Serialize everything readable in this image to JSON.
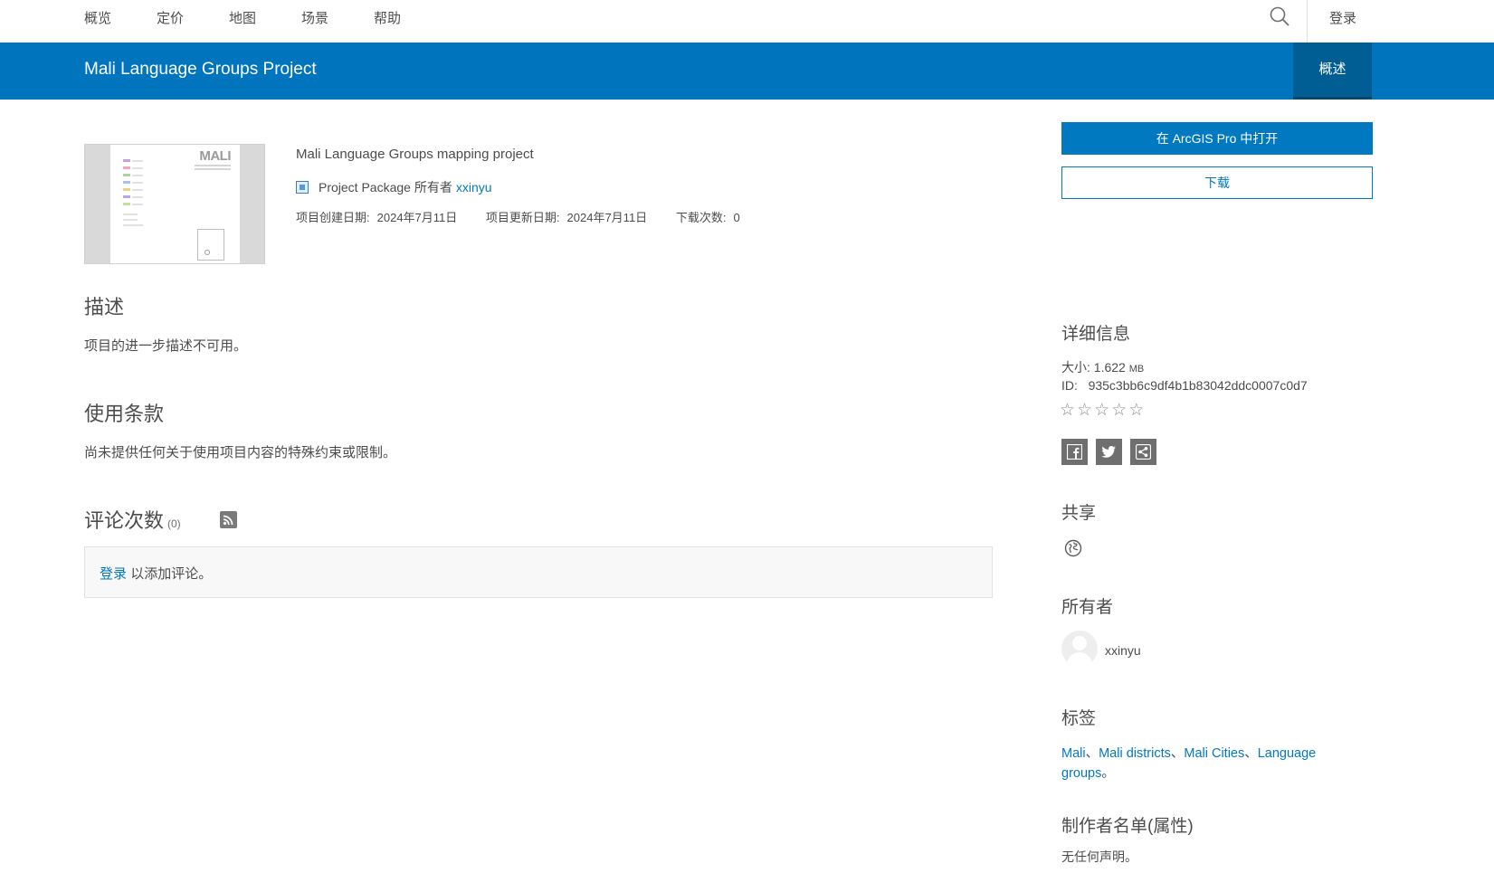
{
  "nav": {
    "items": [
      "概览",
      "定价",
      "地图",
      "场景",
      "帮助"
    ],
    "login": "登录"
  },
  "titlebar": {
    "title": "Mali Language Groups Project",
    "tab": "概述"
  },
  "thumbnail": {
    "map_title": "MALI"
  },
  "item": {
    "snippet": "Mali Language Groups mapping project",
    "type": "Project Package",
    "owner_prefix": "所有者",
    "owner": "xxinyu",
    "created_label": "项目创建日期:",
    "created_value": "2024年7月11日",
    "updated_label": "项目更新日期:",
    "updated_value": "2024年7月11日",
    "downloads_label": "下载次数:",
    "downloads_value": "0"
  },
  "description": {
    "heading": "描述",
    "text": "项目的进一步描述不可用。"
  },
  "terms": {
    "heading": "使用条款",
    "text": "尚未提供任何关于使用项目内容的特殊约束或限制。"
  },
  "comments": {
    "heading": "评论次数",
    "count": "(0)",
    "login_link": "登录",
    "suffix": "以添加评论。"
  },
  "actions": {
    "open_pro": "在 ArcGIS Pro 中打开",
    "download": "下载"
  },
  "details": {
    "heading": "详细信息",
    "size_label": "大小:",
    "size_value": "1.622",
    "size_unit": "MB",
    "id_label": "ID:",
    "id_value": "935c3bb6c9df4b1b83042ddc0007c0d7",
    "rating_stars": 5,
    "rating_value": 0
  },
  "share": {
    "heading": "共享"
  },
  "owner": {
    "heading": "所有者",
    "name": "xxinyu"
  },
  "tags": {
    "heading": "标签",
    "items": [
      "Mali",
      "Mali districts",
      "Mali Cities",
      "Language groups"
    ],
    "separator": "、",
    "terminator": "。"
  },
  "credits": {
    "heading": "制作者名单(属性)",
    "text": "无任何声明。"
  },
  "colors": {
    "brand_blue": "#0079c1",
    "title_bar": "#0075be",
    "active_tab": "#005e95"
  }
}
